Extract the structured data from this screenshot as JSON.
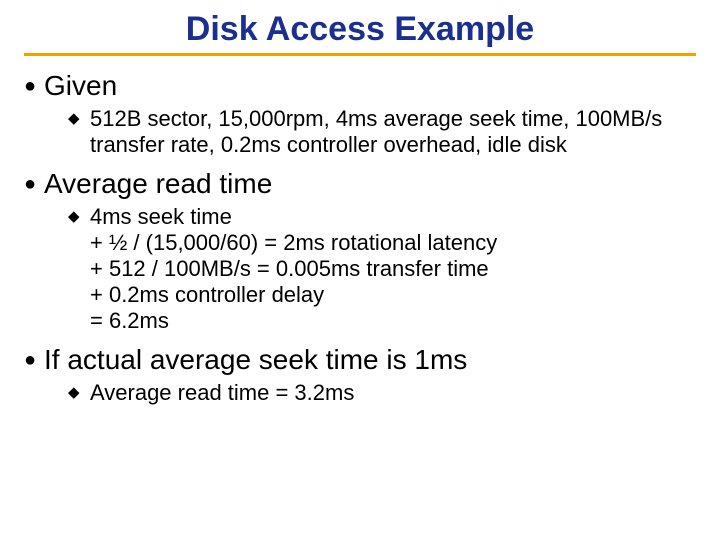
{
  "title": "Disk Access Example",
  "items": [
    {
      "label": "Given",
      "sub": [
        " 512B sector, 15,000rpm, 4ms average seek time, 100MB/s transfer rate, 0.2ms controller overhead, idle disk"
      ]
    },
    {
      "label": "Average read time",
      "sub": [
        " 4ms seek time\n+ ½ / (15,000/60) = 2ms rotational latency\n+ 512 / 100MB/s = 0.005ms transfer time\n+ 0.2ms controller delay\n= 6.2ms"
      ]
    },
    {
      "label": "If actual average seek time is 1ms",
      "sub": [
        " Average read time = 3.2ms"
      ]
    }
  ]
}
